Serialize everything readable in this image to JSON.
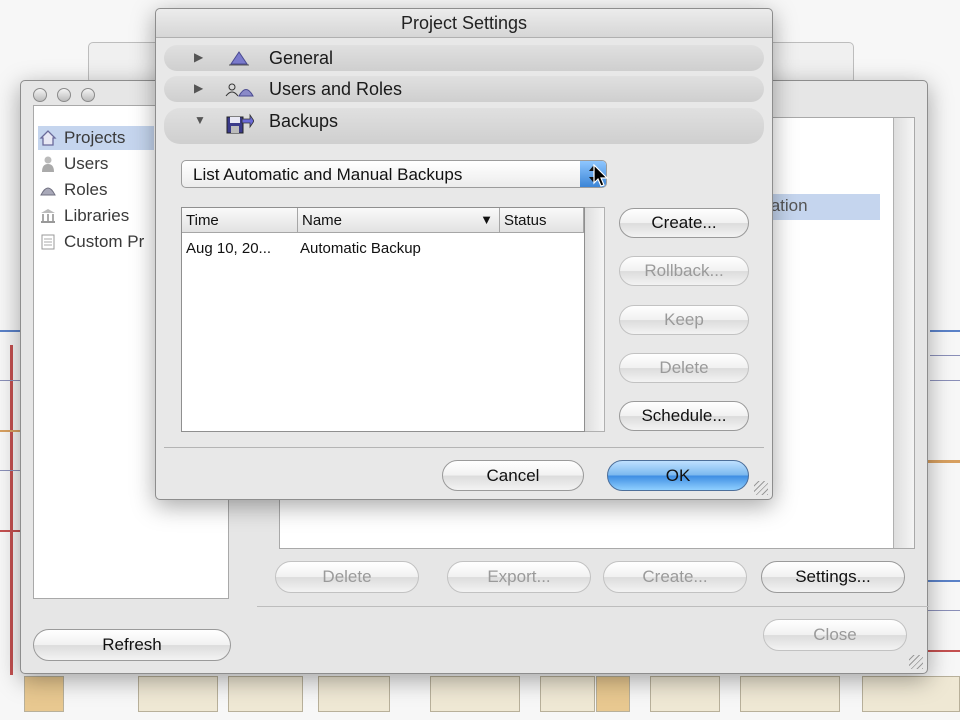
{
  "dialog": {
    "title": "Project Settings",
    "sections": [
      {
        "label": "General",
        "icon": "triangle-icon",
        "expanded": false
      },
      {
        "label": "Users and Roles",
        "icon": "users-icon",
        "expanded": false
      },
      {
        "label": "Backups",
        "icon": "backup-icon",
        "expanded": true
      }
    ],
    "backup_filter": "List Automatic and Manual Backups",
    "table": {
      "columns": [
        "Time",
        "Name",
        "Status"
      ],
      "rows": [
        {
          "time": "Aug 10, 20...",
          "name": "Automatic Backup",
          "status": ""
        }
      ]
    },
    "side_buttons": {
      "create": "Create...",
      "rollback": "Rollback...",
      "keep": "Keep",
      "delete": "Delete",
      "schedule": "Schedule..."
    },
    "cancel": "Cancel",
    "ok": "OK"
  },
  "main_window": {
    "sidebar": [
      {
        "label": "Projects",
        "icon": "house-icon"
      },
      {
        "label": "Users",
        "icon": "user-icon"
      },
      {
        "label": "Roles",
        "icon": "role-icon"
      },
      {
        "label": "Libraries",
        "icon": "library-icon"
      },
      {
        "label": "Custom Pr",
        "icon": "document-icon"
      }
    ],
    "list_partial": "tation",
    "refresh": "Refresh",
    "buttons": {
      "delete": "Delete",
      "export": "Export...",
      "create": "Create...",
      "settings": "Settings...",
      "close": "Close"
    }
  },
  "colors": {
    "selection": "#c5d5ee",
    "default_button": "#3f8ee3",
    "background": "#e6e6e6"
  }
}
